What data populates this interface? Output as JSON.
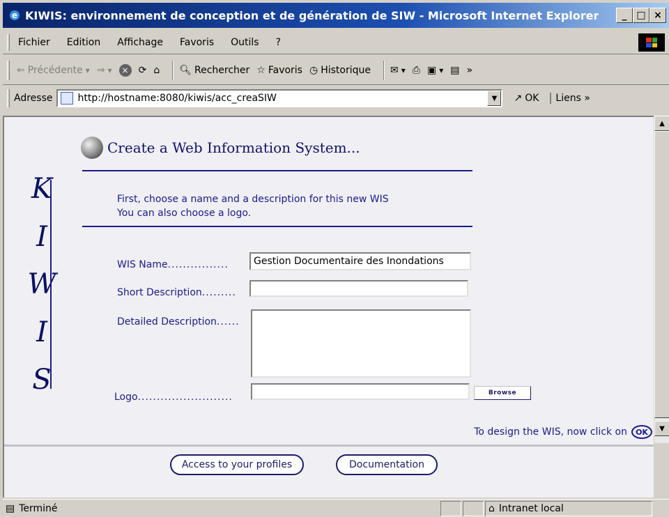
{
  "window": {
    "title": "KIWIS: environnement de conception et de génération de SIW - Microsoft Internet Explorer",
    "caption_minimize": "_",
    "caption_maximize": "□",
    "caption_close": "×"
  },
  "menu": {
    "items": [
      "Fichier",
      "Edition",
      "Affichage",
      "Favoris",
      "Outils",
      "?"
    ]
  },
  "toolbar": {
    "back": "Précédente",
    "search": "Rechercher",
    "favorites": "Favoris",
    "history": "Historique",
    "more": "»"
  },
  "address": {
    "label": "Adresse",
    "url": "http://hostname:8080/kiwis/acc_creaSIW",
    "go": "OK",
    "links": "Liens",
    "links_more": "»"
  },
  "page": {
    "title": "Create a Web Information System...",
    "kiwis_letters": [
      "K",
      "I",
      "W",
      "I",
      "S"
    ],
    "intro_line1": "First, choose a name and a description for this new WIS",
    "intro_line2": "You can also choose a logo.",
    "wis_name_label": "WIS Name",
    "wis_name_value": "Gestion Documentaire des Inondations",
    "short_desc_label": "Short Description",
    "short_desc_value": "",
    "detailed_desc_label": "Detailed Description",
    "detailed_desc_value": "",
    "logo_label": "Logo",
    "logo_value": "",
    "browse_label": "Browse",
    "design_hint": "To design the WIS, now click on",
    "ok_badge": "OK",
    "profiles_button": "Access to your profiles",
    "documentation_button": "Documentation"
  },
  "status": {
    "text": "Terminé",
    "zone": "Intranet local"
  },
  "colors": {
    "accent": "#1a1a8a",
    "titlebar_start": "#0a246a",
    "chrome": "#d4d0c8"
  }
}
